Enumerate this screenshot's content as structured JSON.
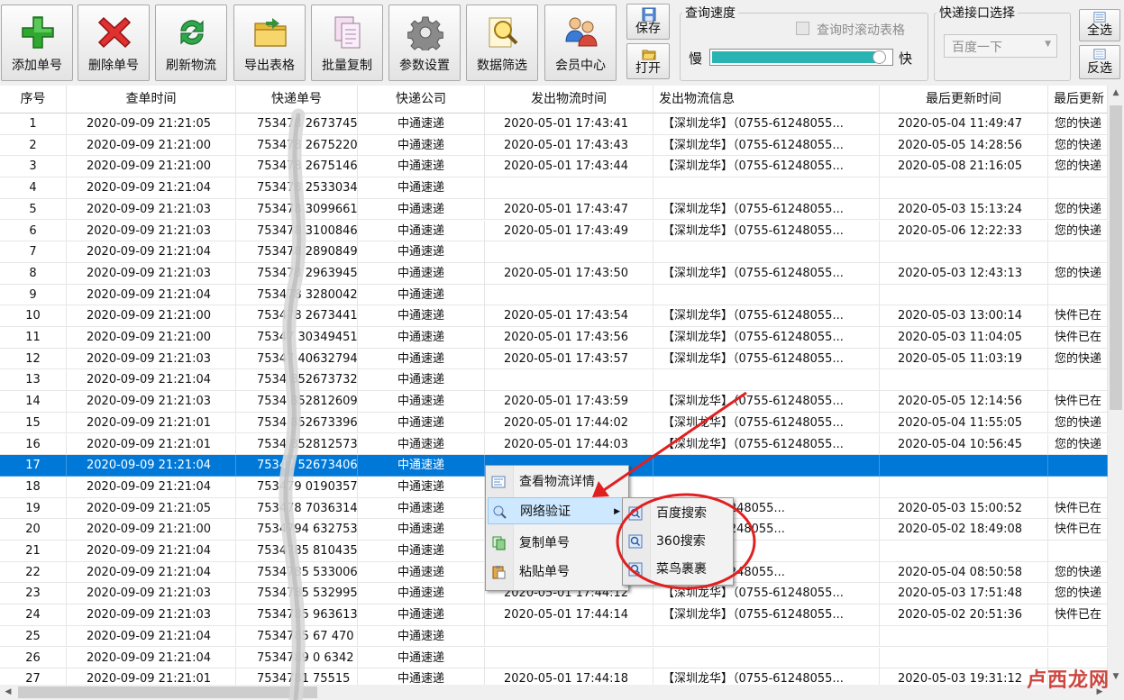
{
  "toolbar": {
    "add_label": "添加单号",
    "delete_label": "删除单号",
    "refresh_label": "刷新物流",
    "export_label": "导出表格",
    "copy_label": "批量复制",
    "settings_label": "参数设置",
    "filter_label": "数据筛选",
    "member_label": "会员中心",
    "save_label": "保存",
    "open_label": "打开",
    "select_all_label": "全选",
    "invert_label": "反选"
  },
  "speed_group": {
    "title": "查询速度",
    "scroll_checkbox_label": "查询时滚动表格",
    "scroll_checkbox_checked": false,
    "slow_label": "慢",
    "fast_label": "快",
    "speed_fraction": 0.97,
    "slider_color": "#2ab3b3"
  },
  "api_group": {
    "title": "快递接口选择",
    "selected": "百度一下"
  },
  "table": {
    "headers": [
      "序号",
      "查单时间",
      "快递单号",
      "快递公司",
      "发出物流时间",
      "发出物流信息",
      "最后更新时间",
      "最后更新"
    ],
    "selected_row": 17,
    "selection_color": "#0078d7",
    "rows": [
      [
        "1",
        "2020-09-09 21:21:05",
        "753478 2673745",
        "中通速递",
        "2020-05-01 17:43:41",
        "【深圳龙华】（0755-61248055...",
        "2020-05-04 11:49:47",
        "您的快递"
      ],
      [
        "2",
        "2020-09-09 21:21:00",
        "753478 2675220",
        "中通速递",
        "2020-05-01 17:43:43",
        "【深圳龙华】（0755-61248055...",
        "2020-05-05 14:28:56",
        "您的快递"
      ],
      [
        "3",
        "2020-09-09 21:21:00",
        "753478 2675146",
        "中通速递",
        "2020-05-01 17:43:44",
        "【深圳龙华】（0755-61248055...",
        "2020-05-08 21:16:05",
        "您的快递"
      ],
      [
        "4",
        "2020-09-09 21:21:04",
        "753478 2533034",
        "中通速递",
        "",
        "",
        "",
        ""
      ],
      [
        "5",
        "2020-09-09 21:21:03",
        "753478 3099661",
        "中通速递",
        "2020-05-01 17:43:47",
        "【深圳龙华】（0755-61248055...",
        "2020-05-03 15:13:24",
        "您的快递"
      ],
      [
        "6",
        "2020-09-09 21:21:03",
        "753478 3100846",
        "中通速递",
        "2020-05-01 17:43:49",
        "【深圳龙华】（0755-61248055...",
        "2020-05-06 12:22:33",
        "您的快递"
      ],
      [
        "7",
        "2020-09-09 21:21:04",
        "753478 2890849",
        "中通速递",
        "",
        "",
        "",
        ""
      ],
      [
        "8",
        "2020-09-09 21:21:03",
        "753478 2963945",
        "中通速递",
        "2020-05-01 17:43:50",
        "【深圳龙华】（0755-61248055...",
        "2020-05-03 12:43:13",
        "您的快递"
      ],
      [
        "9",
        "2020-09-09 21:21:04",
        "753478 3280042",
        "中通速递",
        "",
        "",
        "",
        ""
      ],
      [
        "10",
        "2020-09-09 21:21:00",
        "753478 2673441",
        "中通速递",
        "2020-05-01 17:43:54",
        "【深圳龙华】（0755-61248055...",
        "2020-05-03 13:00:14",
        "快件已在"
      ],
      [
        "11",
        "2020-09-09 21:21:00",
        "75347 30349451",
        "中通速递",
        "2020-05-01 17:43:56",
        "【深圳龙华】（0755-61248055...",
        "2020-05-03 11:04:05",
        "快件已在"
      ],
      [
        "12",
        "2020-09-09 21:21:03",
        "75347 40632794",
        "中通速递",
        "2020-05-01 17:43:57",
        "【深圳龙华】（0755-61248055...",
        "2020-05-05 11:03:19",
        "您的快递"
      ],
      [
        "13",
        "2020-09-09 21:21:04",
        "7534 852673732",
        "中通速递",
        "",
        "",
        "",
        ""
      ],
      [
        "14",
        "2020-09-09 21:21:03",
        "7534 852812609",
        "中通速递",
        "2020-05-01 17:43:59",
        "【深圳龙华】（0755-61248055...",
        "2020-05-05 12:14:56",
        "快件已在"
      ],
      [
        "15",
        "2020-09-09 21:21:01",
        "7534 852673396",
        "中通速递",
        "2020-05-01 17:44:02",
        "【深圳龙华】（0755-61248055...",
        "2020-05-04 11:55:05",
        "您的快递"
      ],
      [
        "16",
        "2020-09-09 21:21:01",
        "7534 852812573",
        "中通速递",
        "2020-05-01 17:44:03",
        "【深圳龙华】（0755-61248055...",
        "2020-05-04 10:56:45",
        "您的快递"
      ],
      [
        "17",
        "2020-09-09 21:21:04",
        "75347 52673406",
        "中通速递",
        "",
        "",
        "",
        ""
      ],
      [
        "18",
        "2020-09-09 21:21:04",
        "753479 0190357",
        "中通速递",
        "",
        "",
        "",
        ""
      ],
      [
        "19",
        "2020-09-09 21:21:05",
        "753478 7036314",
        "中通速递",
        "",
        "】（0755-61248055...",
        "2020-05-03 15:00:52",
        "快件已在"
      ],
      [
        "20",
        "2020-09-09 21:21:00",
        "7534794 632753",
        "中通速递",
        "",
        "】（0755-61248055...",
        "2020-05-02 18:49:08",
        "快件已在"
      ],
      [
        "21",
        "2020-09-09 21:21:04",
        "7534785 810435",
        "中通速递",
        "",
        "",
        "",
        ""
      ],
      [
        "22",
        "2020-09-09 21:21:04",
        "7534785 533006",
        "中通速递",
        "",
        "】（0755-61248055...",
        "2020-05-04 08:50:58",
        "您的快递"
      ],
      [
        "23",
        "2020-09-09 21:21:03",
        "7534785 532995",
        "中通速递",
        "2020-05-01 17:44:12",
        "【深圳龙华】（0755-61248055...",
        "2020-05-03 17:51:48",
        "您的快递"
      ],
      [
        "24",
        "2020-09-09 21:21:03",
        "7534785 963613",
        "中通速递",
        "2020-05-01 17:44:14",
        "【深圳龙华】（0755-61248055...",
        "2020-05-02 20:51:36",
        "快件已在"
      ],
      [
        "25",
        "2020-09-09 21:21:04",
        "7534785 67 470",
        "中通速递",
        "",
        "",
        "",
        ""
      ],
      [
        "26",
        "2020-09-09 21:21:04",
        "7534789 0 6342",
        "中通速递",
        "",
        "",
        "",
        ""
      ],
      [
        "27",
        "2020-09-09 21:21:01",
        "7534781 75515",
        "中通速递",
        "2020-05-01 17:44:18",
        "【深圳龙华】（0755-61248055...",
        "2020-05-03 19:31:12",
        ""
      ]
    ]
  },
  "context_menu": {
    "items": [
      {
        "label": "查看物流详情",
        "icon": "details-icon"
      },
      {
        "label": "网络验证",
        "icon": "network-icon",
        "has_submenu": true
      },
      {
        "label": "复制单号",
        "icon": "copy-icon"
      },
      {
        "label": "粘贴单号",
        "icon": "paste-icon"
      }
    ],
    "submenu": [
      {
        "label": "百度搜索",
        "icon": "search-icon"
      },
      {
        "label": "360搜索",
        "icon": "search-icon"
      },
      {
        "label": "菜鸟裹裹",
        "icon": "search-icon"
      }
    ]
  },
  "annotation": {
    "color": "#e02020"
  },
  "watermark": {
    "text": "卢西龙网"
  }
}
